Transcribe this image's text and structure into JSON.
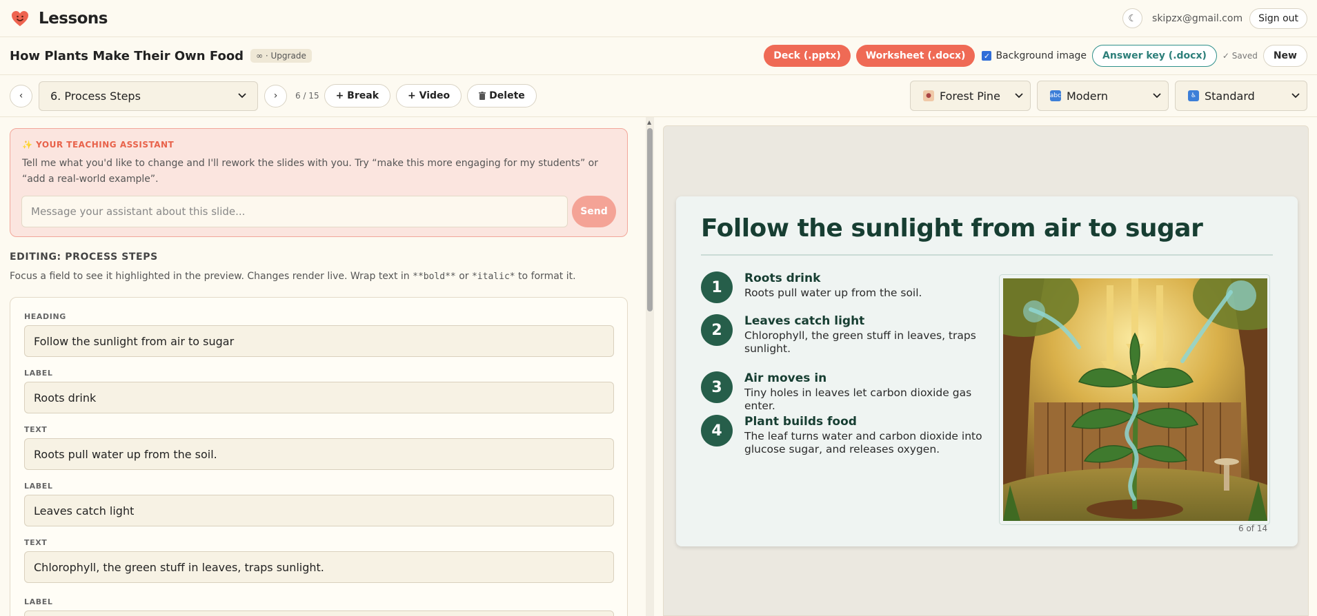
{
  "app": {
    "title": "Lessons",
    "brand_color": "#ef6a55"
  },
  "user": {
    "email": "skipzx@gmail.com",
    "sign_out_label": "Sign out",
    "theme_toggle_icon": "moon-icon"
  },
  "lesson": {
    "title": "How Plants Make Their Own Food",
    "upgrade_chip": "∞ · Upgrade",
    "deck_label": "Deck (.pptx)",
    "worksheet_label": "Worksheet (.docx)",
    "background_image_label": "Background image",
    "background_image_checked": true,
    "answer_key_label": "Answer key (.docx)",
    "saved_label": "✓ Saved",
    "new_label": "New"
  },
  "nav": {
    "prev": "‹",
    "next": "›",
    "selected_slide": "6. Process Steps",
    "slide_counter": "6 / 15",
    "break_label": "+ Break",
    "video_label": "+ Video",
    "delete_label": "Delete",
    "theme": "Forest Pine",
    "style": "Modern",
    "accessibility": "Standard"
  },
  "assistant": {
    "heading": "YOUR TEACHING ASSISTANT",
    "body": "Tell me what you'd like to change and I'll rework the slides with you. Try “make this more engaging for my students” or “add a real-world example”.",
    "placeholder": "Message your assistant about this slide...",
    "send_label": "Send"
  },
  "editor": {
    "section_title": "EDITING: PROCESS STEPS",
    "help_before": "Focus a field to see it highlighted in the preview. Changes render live. Wrap text in ",
    "help_bold": "**bold**",
    "help_or": " or ",
    "help_italic": "*italic*",
    "help_after": " to format it.",
    "fields": [
      {
        "label": "HEADING",
        "value": "Follow the sunlight from air to sugar"
      },
      {
        "label": "LABEL",
        "value": "Roots drink"
      },
      {
        "label": "TEXT",
        "value": "Roots pull water up from the soil."
      },
      {
        "label": "LABEL",
        "value": "Leaves catch light"
      },
      {
        "label": "TEXT",
        "value": "Chlorophyll, the green stuff in leaves, traps sunlight."
      },
      {
        "label": "LABEL",
        "value": ""
      }
    ]
  },
  "slide": {
    "title": "Follow the sunlight from air to sugar",
    "steps": [
      {
        "num": "1",
        "label": "Roots drink",
        "text": "Roots pull water up from the soil."
      },
      {
        "num": "2",
        "label": "Leaves catch light",
        "text": "Chlorophyll, the green stuff in leaves, traps sunlight."
      },
      {
        "num": "3",
        "label": "Air moves in",
        "text": "Tiny holes in leaves let carbon dioxide gas enter."
      },
      {
        "num": "4",
        "label": "Plant builds food",
        "text": "The leaf turns water and carbon dioxide into glucose sugar, and releases oxygen."
      }
    ],
    "footer": "6 of 14",
    "accent_color": "#265e4a"
  }
}
